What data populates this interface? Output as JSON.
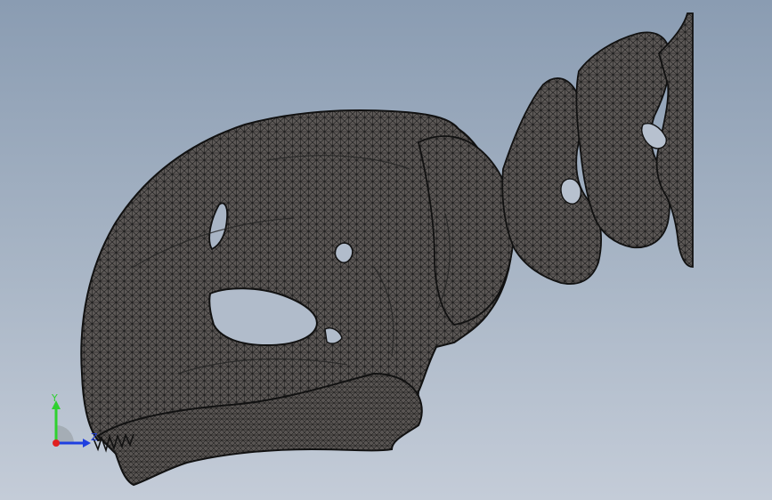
{
  "viewport": {
    "background_top": "#8a9cb2",
    "background_bottom": "#c4ccd8",
    "model_color": "#5f5b59",
    "mesh_color": "#1b1b1b"
  },
  "model": {
    "render_mode": "shaded-with-edges",
    "subject": "skull-and-vertebrae-mesh"
  },
  "triad": {
    "y_label": "Y",
    "z_label": "Z",
    "y_color": "#2fd12f",
    "z_color": "#1f3fe0",
    "x_color": "#e01f1f"
  }
}
